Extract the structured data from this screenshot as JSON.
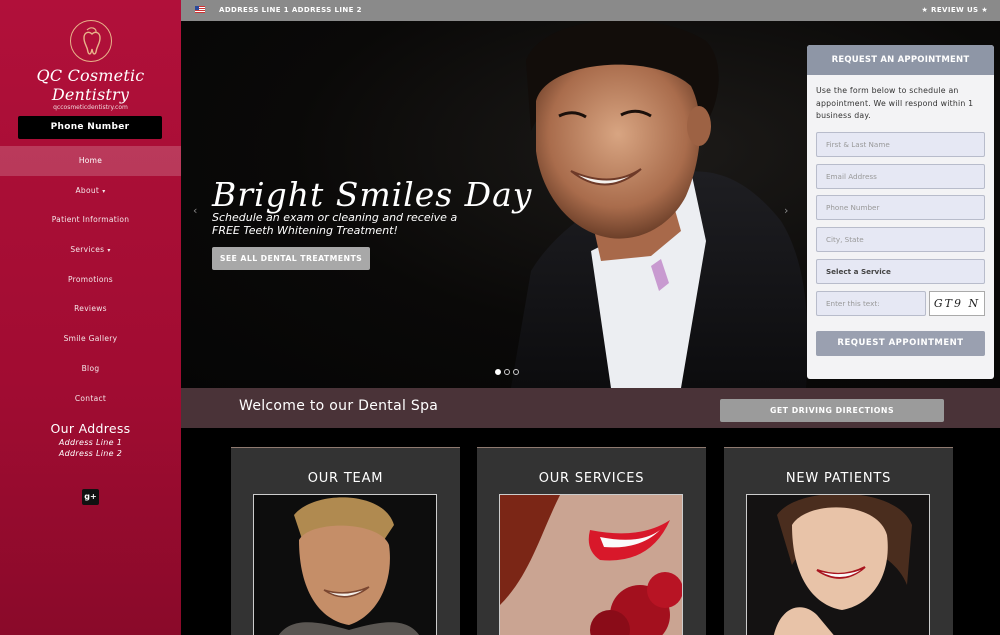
{
  "sidebar": {
    "logo_name": "QC Cosmetic Dentistry",
    "logo_url": "qccosmeticdentistry.com",
    "phone_label": "Phone Number",
    "nav": [
      {
        "label": "Home",
        "active": true
      },
      {
        "label": "About",
        "caret": "▾"
      },
      {
        "label": "Patient Information"
      },
      {
        "label": "Services",
        "caret": "▾"
      },
      {
        "label": "Promotions"
      },
      {
        "label": "Reviews"
      },
      {
        "label": "Smile Gallery"
      },
      {
        "label": "Blog"
      },
      {
        "label": "Contact"
      }
    ],
    "address_title": "Our Address",
    "address_line1": "Address Line 1",
    "address_line2": "Address Line 2",
    "social_icon": "g+"
  },
  "topbar": {
    "address": "ADDRESS LINE 1 ADDRESS LINE 2",
    "review": "★ REVIEW US ★"
  },
  "hero": {
    "title": "Bright Smiles Day",
    "subtitle": "Schedule an exam or cleaning and receive a FREE Teeth Whitening Treatment!",
    "button": "SEE ALL DENTAL TREATMENTS",
    "prev": "‹",
    "next": "›"
  },
  "form": {
    "heading": "REQUEST AN APPOINTMENT",
    "intro": "Use the form below to schedule an appointment. We will respond within 1 business day.",
    "fields": {
      "name": "First & Last Name",
      "email": "Email Address",
      "phone": "Phone Number",
      "city": "City, State",
      "service": "Select a Service",
      "captcha": "Enter this text:"
    },
    "captcha_text": "GT9 N",
    "submit": "REQUEST APPOINTMENT"
  },
  "welcome": {
    "text": "Welcome to our Dental Spa",
    "button": "GET DRIVING DIRECTIONS"
  },
  "cards": {
    "team": "OUR TEAM",
    "services": "OUR SERVICES",
    "patients": "NEW PATIENTS"
  },
  "colors": {
    "sidebar": "#a80e36",
    "topbar": "#8a8a8a",
    "welcome_band": "#4a3338",
    "form_header": "#8e96a6"
  }
}
